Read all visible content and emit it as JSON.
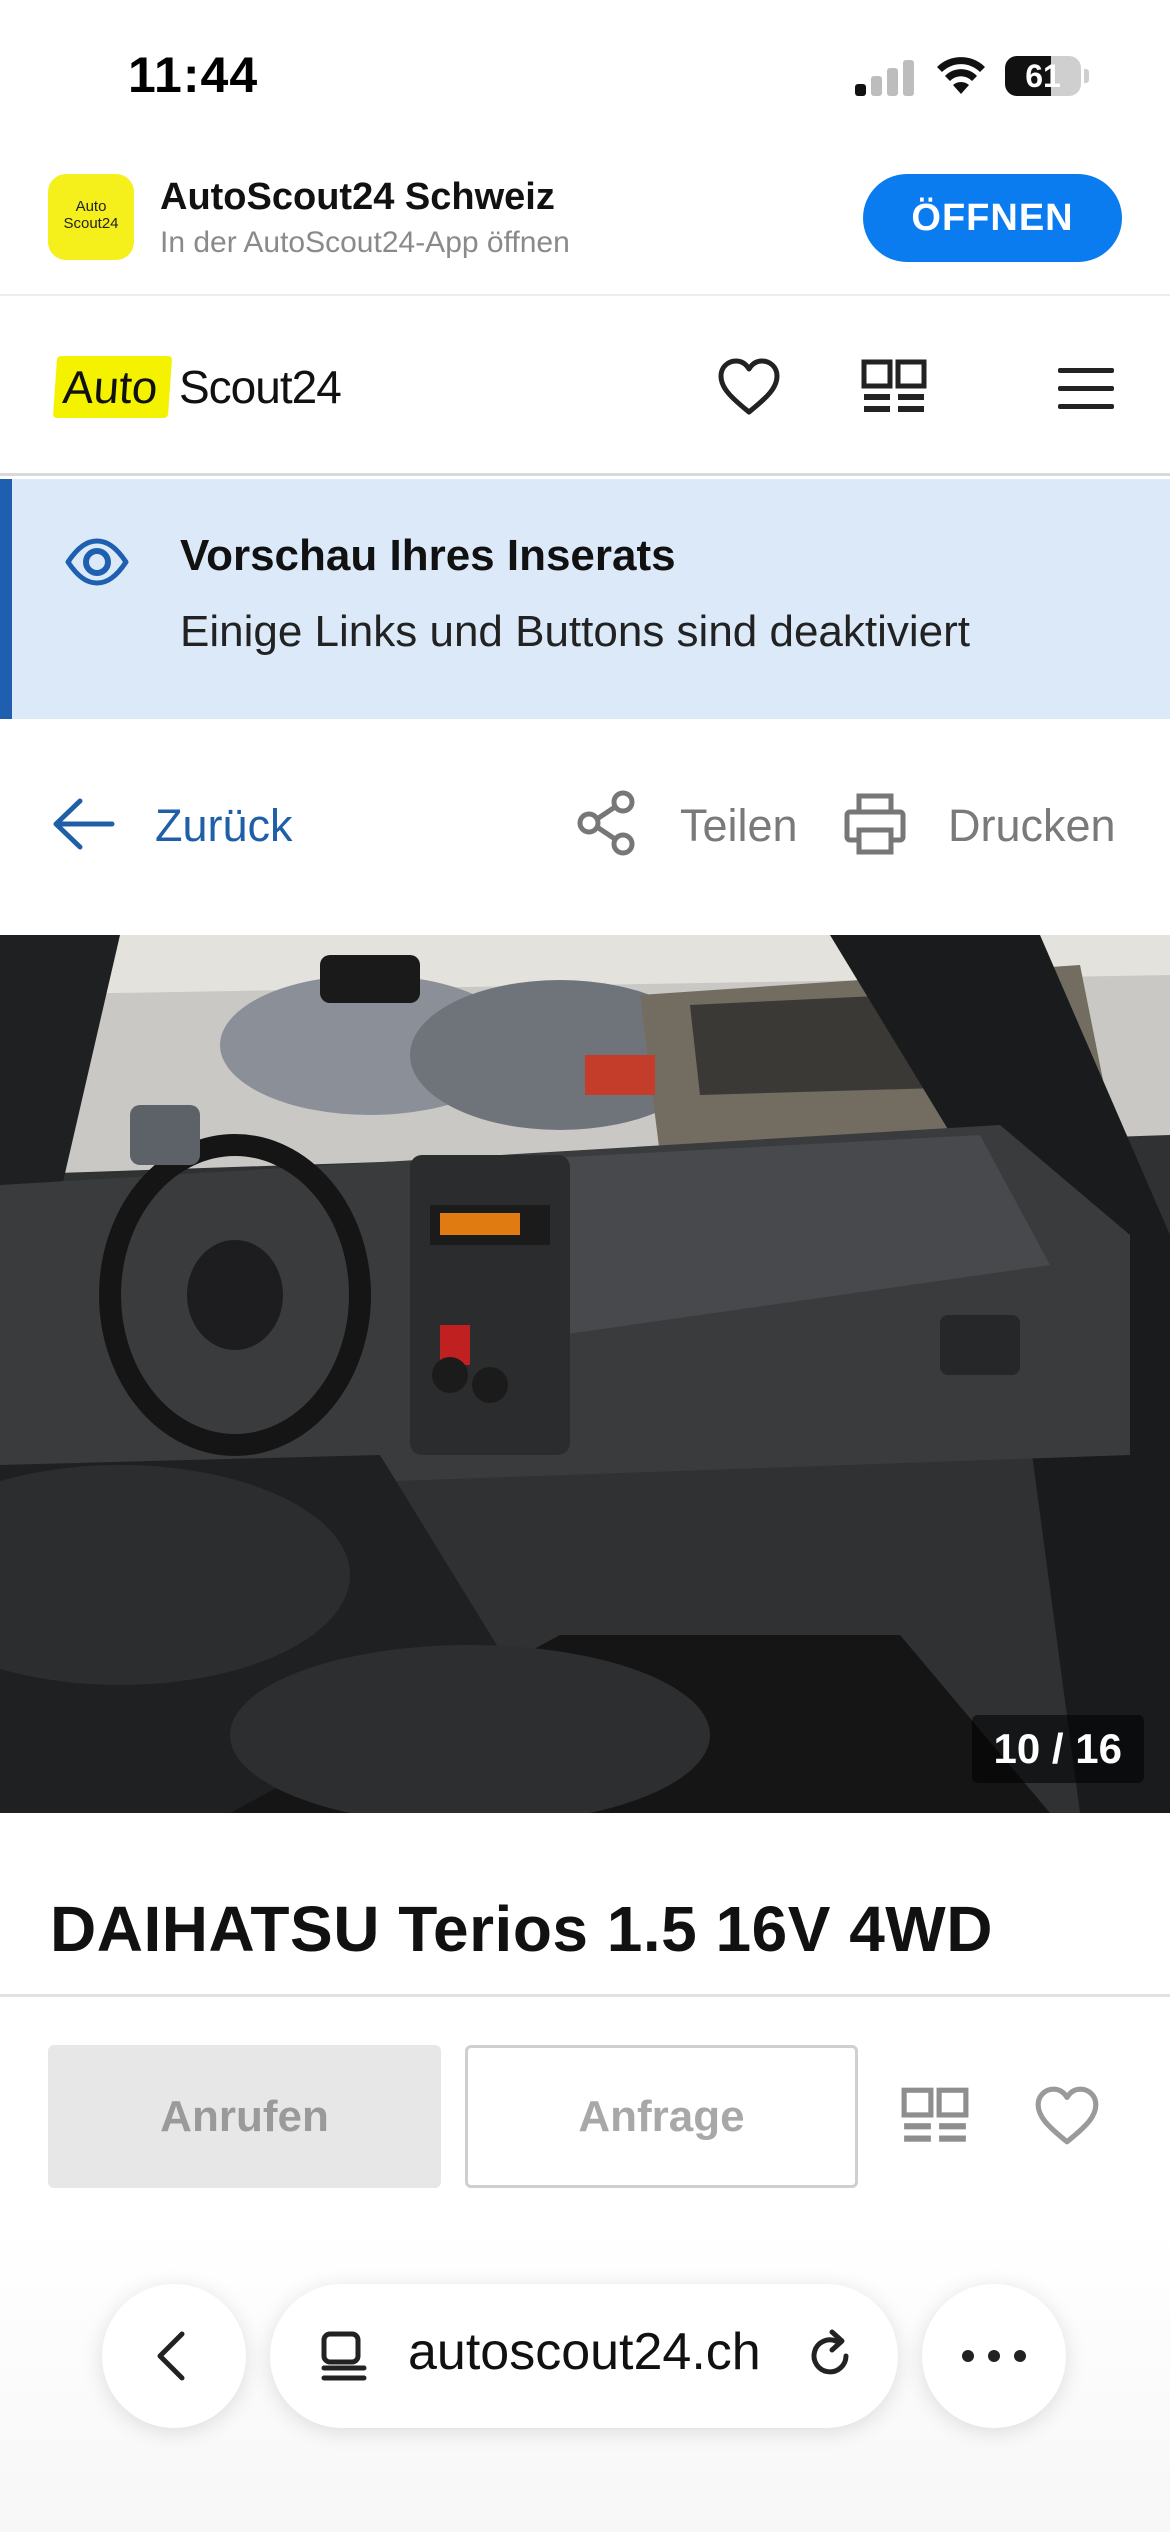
{
  "status_bar": {
    "time": "11:44",
    "battery": "61",
    "battery_level": 0.61
  },
  "app_banner": {
    "icon_text_line1": "Auto",
    "icon_text_line2": "Scout24",
    "title": "AutoScout24 Schweiz",
    "subtitle": "In der AutoScout24-App öffnen",
    "open_label": "ÖFFNEN"
  },
  "header": {
    "logo_part1": "Auto",
    "logo_part2": "Scout24",
    "icons": [
      "heart-icon",
      "compare-icon",
      "menu-icon"
    ]
  },
  "preview_notice": {
    "title": "Vorschau Ihres Inserats",
    "text": "Einige Links und Buttons sind deaktiviert"
  },
  "actions": {
    "back_label": "Zurück",
    "share_label": "Teilen",
    "print_label": "Drucken"
  },
  "gallery": {
    "counter": "10 / 16"
  },
  "listing": {
    "title": "DAIHATSU Terios 1.5 16V 4WD"
  },
  "contact": {
    "call_label": "Anrufen",
    "inquiry_label": "Anfrage"
  },
  "browser": {
    "url": "autoscout24.ch"
  },
  "colors": {
    "brand_yellow": "#f5f200",
    "link_blue": "#1f5fa8",
    "open_button_blue": "#0a7cf0",
    "preview_bg": "#dce9f9"
  }
}
